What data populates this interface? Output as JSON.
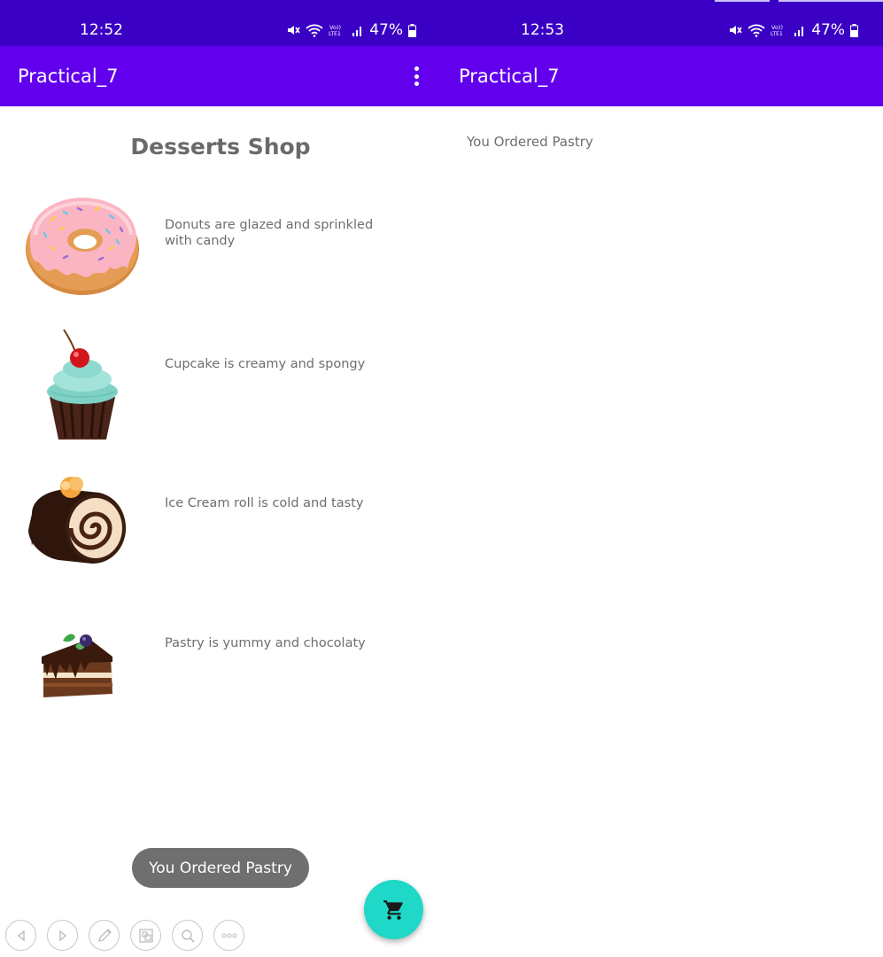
{
  "left_screen": {
    "status_bar": {
      "time": "12:52",
      "battery": "47%"
    },
    "app_bar": {
      "title": "Practical_7",
      "menu_icon": "more-vert-icon"
    },
    "heading": "Desserts Shop",
    "items": [
      {
        "name": "Donut",
        "image": "donut-image",
        "description": "Donuts are glazed and sprinkled with candy"
      },
      {
        "name": "Cupcake",
        "image": "cupcake-image",
        "description": "Cupcake is creamy and spongy"
      },
      {
        "name": "Ice Cream roll",
        "image": "ice-cream-roll-image",
        "description": "Ice Cream roll is cold and tasty"
      },
      {
        "name": "Pastry",
        "image": "pastry-image",
        "description": "Pastry is yummy and chocolaty"
      }
    ],
    "toast": "You Ordered Pastry",
    "fab": {
      "icon": "shopping-cart-icon",
      "color": "#1fd8c7"
    }
  },
  "right_screen": {
    "status_bar": {
      "time": "12:53",
      "battery": "47%"
    },
    "app_bar": {
      "title": "Practical_7"
    },
    "message": "You Ordered Pastry"
  },
  "floating_toolbar": {
    "buttons": [
      "back-icon",
      "forward-icon",
      "pen-icon",
      "screenshot-icon",
      "search-icon",
      "more-icon"
    ]
  },
  "colors": {
    "status_bar": "#3a00c4",
    "app_bar": "#6200ee",
    "text_gray": "#6e6e6e",
    "toast": "#6f6f6f",
    "fab": "#1fd8c7"
  }
}
